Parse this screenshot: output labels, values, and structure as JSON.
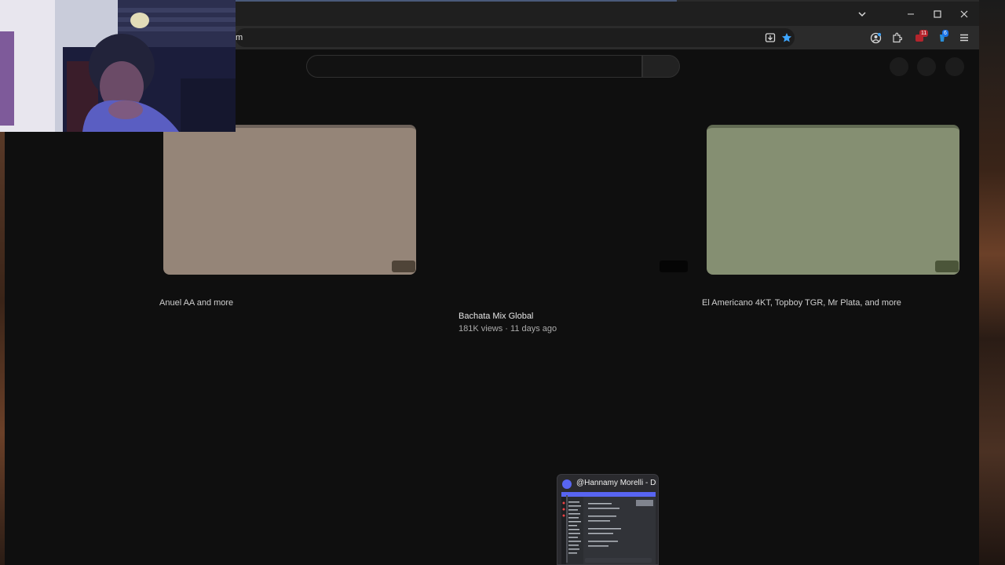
{
  "browser": {
    "url_visible_text": "m",
    "window_controls": {
      "dropdown_icon": "chevron-down-icon",
      "minimize_icon": "minimize-icon",
      "maximize_icon": "maximize-icon",
      "close_icon": "close-icon"
    },
    "toolbar_icons": [
      "install-icon",
      "bookmark-star-icon",
      "profile-icon",
      "extensions-icon",
      "extension-red-icon",
      "extension-blue-icon",
      "menu-icon"
    ],
    "badges": {
      "red_extension": "11",
      "blue_extension": "6"
    },
    "accent_color": "#3ea6ff"
  },
  "youtube": {
    "search_placeholder": "",
    "cards": [
      {
        "channel_line": "Anuel AA and more"
      },
      {
        "title": "Bachata Mix Global",
        "meta": "181K views · 11 days ago"
      },
      {
        "channel_line": "El Americano 4KT, Topboy TGR, Mr Plata, and more"
      }
    ]
  },
  "taskbar_popup": {
    "title": "@Hannamy Morelli - Di...",
    "icon": "discord-icon",
    "brand_color": "#5865f2"
  }
}
